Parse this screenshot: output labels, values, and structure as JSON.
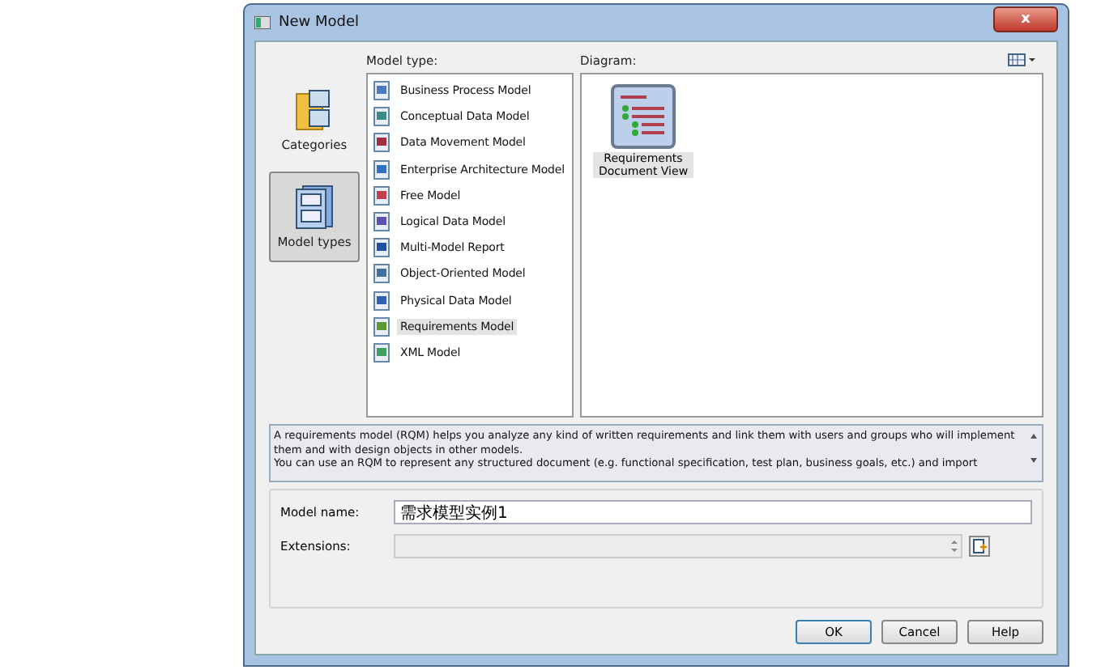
{
  "window": {
    "title": "New Model",
    "close": "x"
  },
  "sidebar": {
    "items": [
      {
        "label": "Categories",
        "selected": false
      },
      {
        "label": "Model types",
        "selected": true
      }
    ]
  },
  "model_type": {
    "label": "Model type:",
    "items": [
      {
        "label": "Business Process Model",
        "selected": false
      },
      {
        "label": "Conceptual Data Model",
        "selected": false
      },
      {
        "label": "Data Movement Model",
        "selected": false
      },
      {
        "label": "Enterprise Architecture Model",
        "selected": false
      },
      {
        "label": "Free Model",
        "selected": false
      },
      {
        "label": "Logical Data Model",
        "selected": false
      },
      {
        "label": "Multi-Model Report",
        "selected": false
      },
      {
        "label": "Object-Oriented Model",
        "selected": false
      },
      {
        "label": "Physical Data Model",
        "selected": false
      },
      {
        "label": "Requirements Model",
        "selected": true
      },
      {
        "label": "XML Model",
        "selected": false
      }
    ]
  },
  "diagram": {
    "label": "Diagram:",
    "items": [
      {
        "label": "Requirements Document View",
        "selected": true
      }
    ]
  },
  "description": "A requirements model (RQM) helps you analyze any kind of written requirements and link them with users and groups who will implement them and with design objects in other models.\nYou can use an RQM to represent any structured document (e.g. functional specification, test plan, business goals, etc.) and import",
  "form": {
    "name_label": "Model name:",
    "name_value": "需求模型实例1",
    "extensions_label": "Extensions:"
  },
  "buttons": [
    {
      "label": "OK",
      "default": true
    },
    {
      "label": "Cancel",
      "default": false
    },
    {
      "label": "Help",
      "default": false
    }
  ]
}
